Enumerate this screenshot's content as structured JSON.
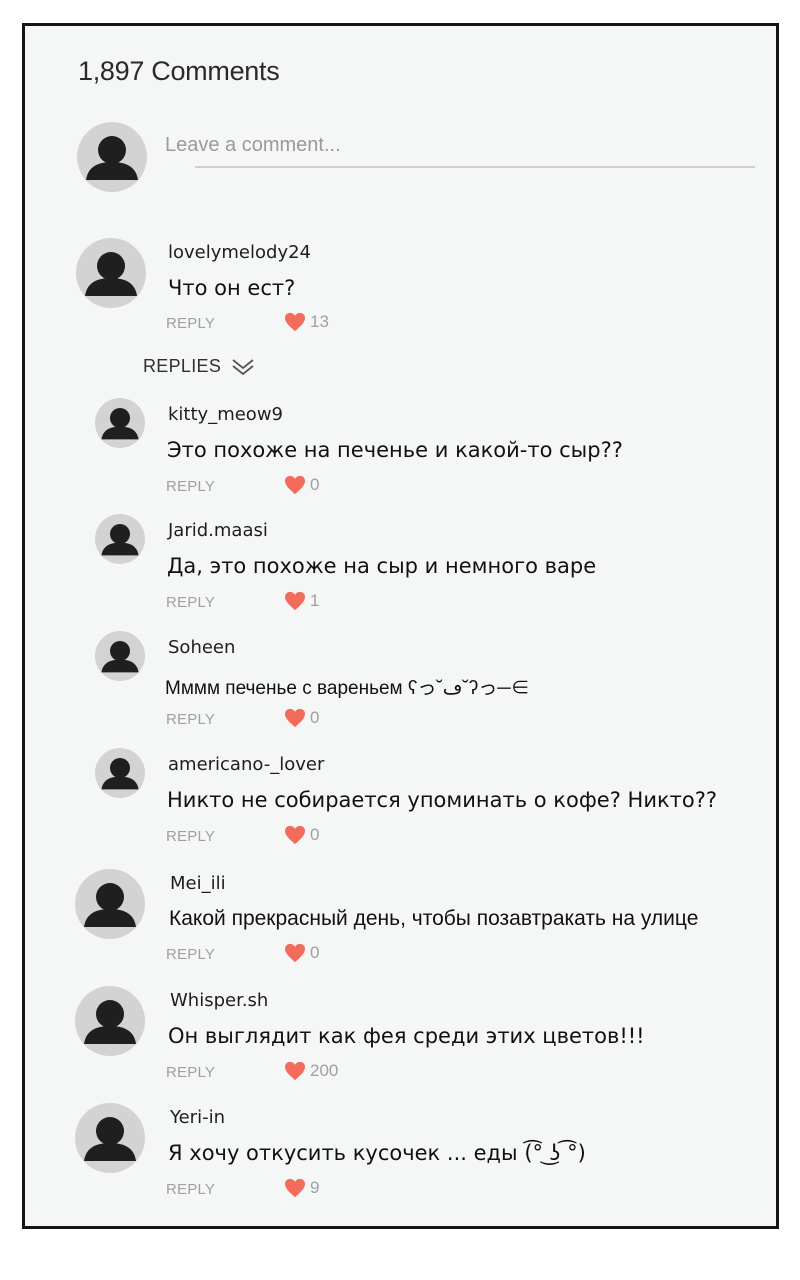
{
  "header": {
    "count_label": "1,897 Comments"
  },
  "compose": {
    "placeholder": "Leave a comment..."
  },
  "labels": {
    "reply": "REPLY",
    "replies": "REPLIES"
  },
  "colors": {
    "heart": "#f26b5b",
    "meta": "#a0a0a0",
    "avatar_bg": "#d3d3d3",
    "avatar_fg": "#1f1f1f"
  },
  "icons": {
    "avatar": "person-silhouette-icon",
    "like": "heart-icon",
    "replies_toggle": "double-chevron-down-icon"
  },
  "main_comment": {
    "user": "lovelymelody24",
    "text": "Что он ест?",
    "likes": "13"
  },
  "replies": [
    {
      "user": "kitty_meow9",
      "text": "Это похоже на печенье и какой-то сыр??",
      "likes": "0"
    },
    {
      "user": "Jarid.maasi",
      "text": "Да, это похоже на сыр и немного варе",
      "likes": "1"
    },
    {
      "user": "Soheen",
      "text": "Мммм печенье с вареньем ʕっ˘ڡ˘ʔっ─∈",
      "likes": "0"
    },
    {
      "user": "americano-_lover",
      "text": "Никто не собирается упоминать о кофе? Никто??",
      "likes": "0"
    }
  ],
  "comments": [
    {
      "user": "Mei_ili",
      "text": "Какой прекрасный день, чтобы позавтракать на улице",
      "likes": "0"
    },
    {
      "user": "Whisper.sh",
      "text": "Он выглядит как фея среди этих цветов!!!",
      "likes": "200"
    },
    {
      "user": "Yeri-in",
      "text": "Я хочу откусить кусочек ... еды (͡° ͜ʖ ͡°)",
      "likes": "9"
    }
  ]
}
